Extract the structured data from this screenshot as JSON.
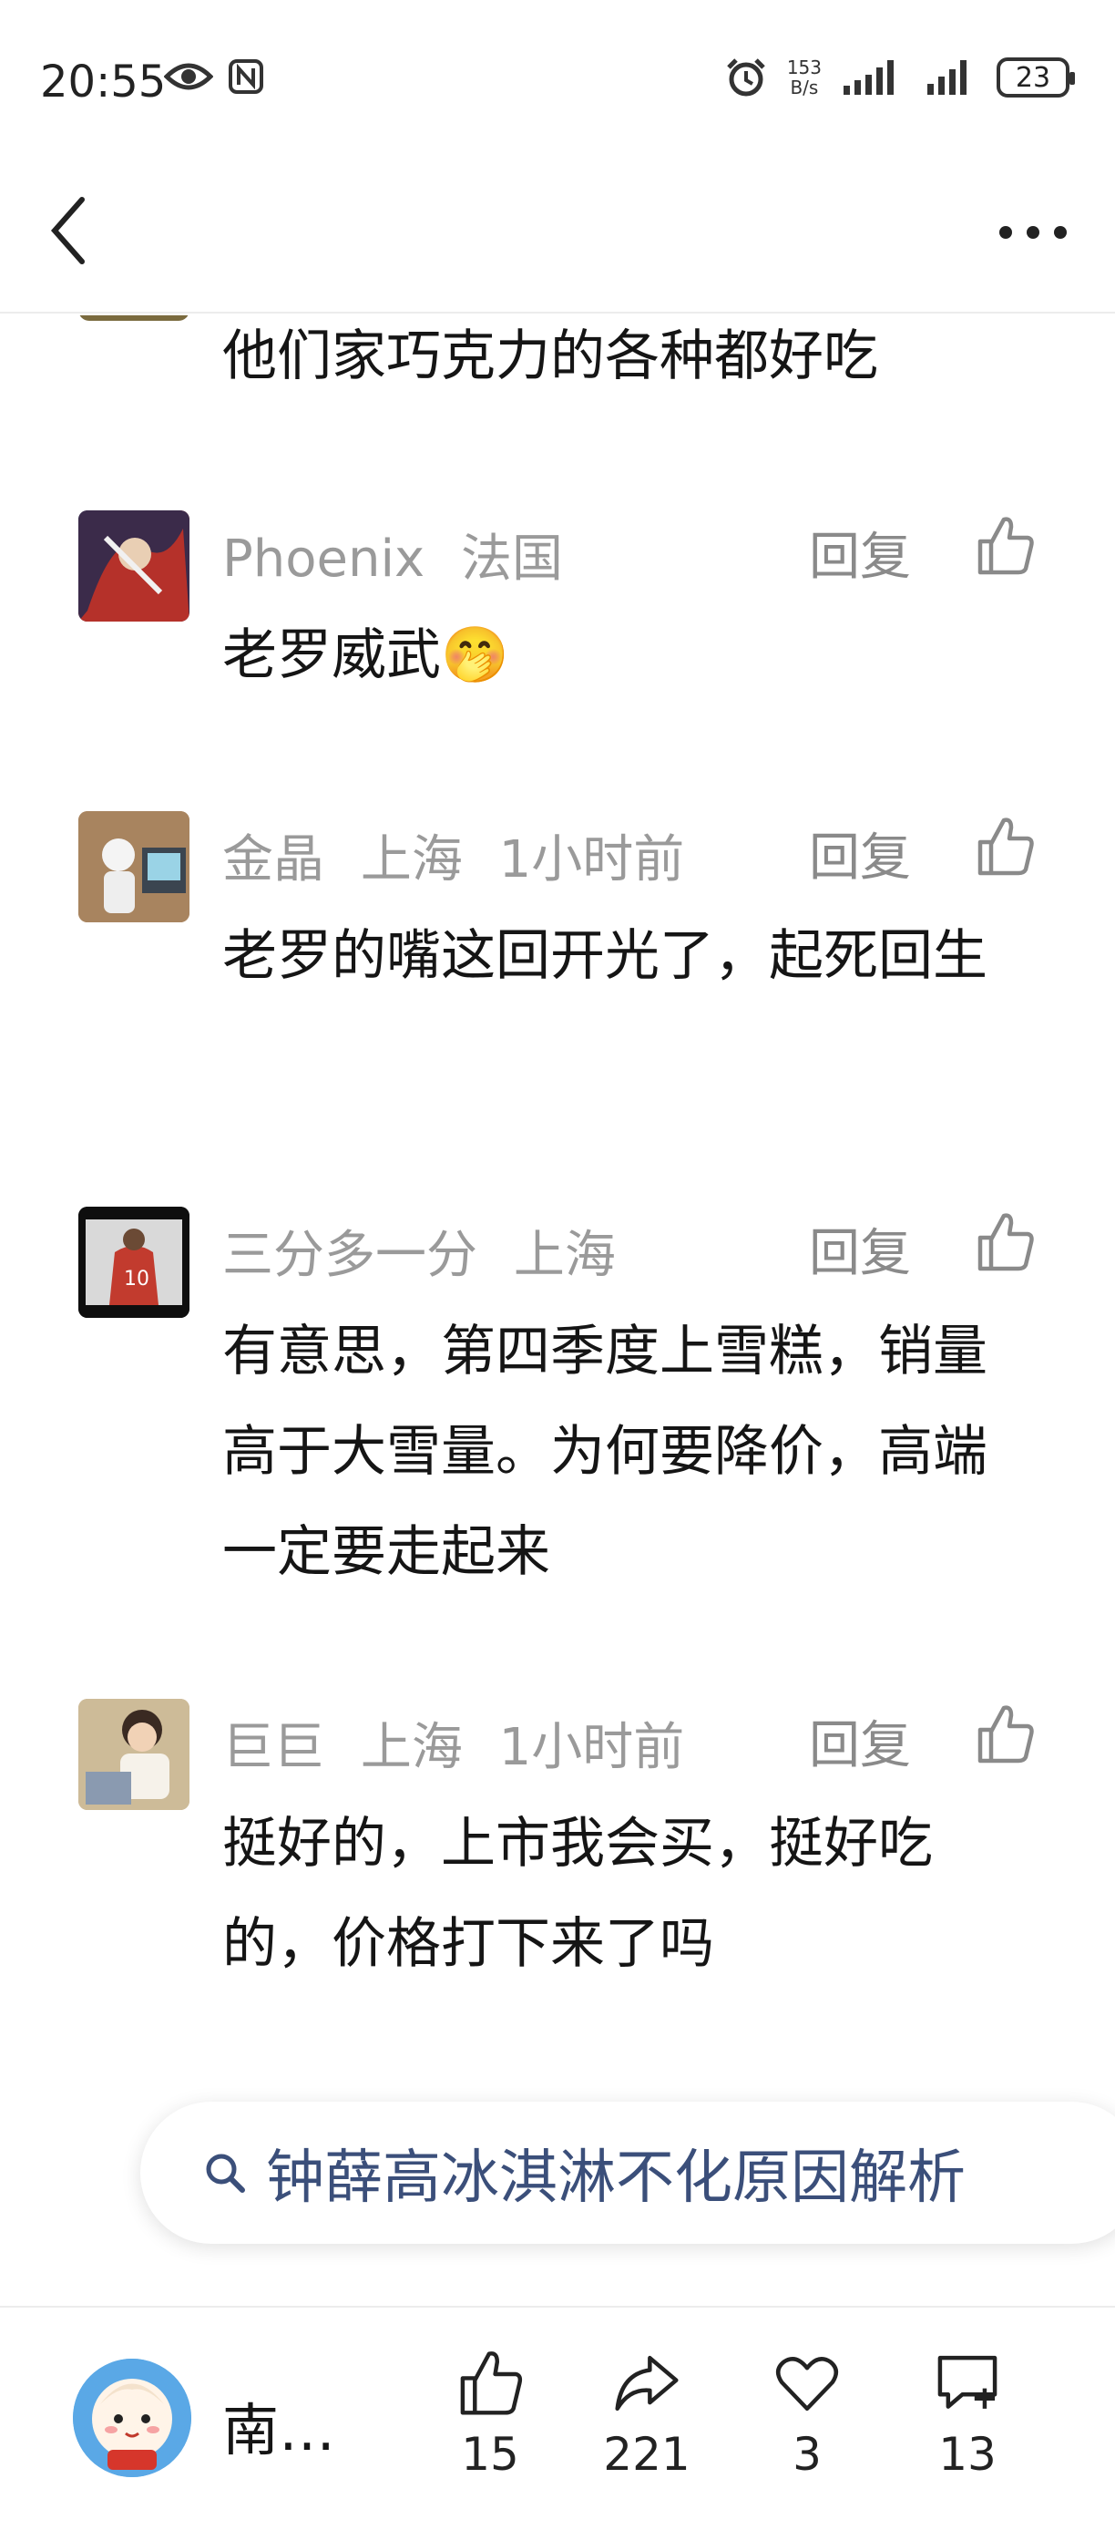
{
  "status": {
    "time": "20:55",
    "net_speed_value": "153",
    "net_speed_unit": "B/s",
    "battery": "23"
  },
  "comments": {
    "partial_text": "他们家巧克力的各种都好吃",
    "items": [
      {
        "user": "Phoenix",
        "location": "法国",
        "time": "",
        "reply": "回复",
        "text": "老罗威武🤭"
      },
      {
        "user": "金晶",
        "location": "上海",
        "time": "1小时前",
        "reply": "回复",
        "text": "老罗的嘴这回开光了，起死回生"
      },
      {
        "user": "三分多一分",
        "location": "上海",
        "time": "",
        "reply": "回复",
        "text": "有意思，第四季度上雪糕，销量高于大雪量。为何要降价，高端一定要走起来"
      },
      {
        "user": "巨巨",
        "location": "上海",
        "time": "1小时前",
        "reply": "回复",
        "text": "挺好的，上市我会买，挺好吃的，价格打下来了吗"
      }
    ]
  },
  "search": {
    "query": "钟薛高冰淇淋不化原因解析"
  },
  "bottom": {
    "author_name": "南…",
    "likes": "15",
    "shares": "221",
    "favorites": "3",
    "comments": "13"
  },
  "icons": {
    "back": "chevron-left-icon",
    "more": "ellipsis-icon",
    "like": "thumbs-up-icon",
    "share": "share-arrow-icon",
    "favorite": "heart-icon",
    "comment": "comment-plus-icon",
    "search": "search-icon"
  }
}
